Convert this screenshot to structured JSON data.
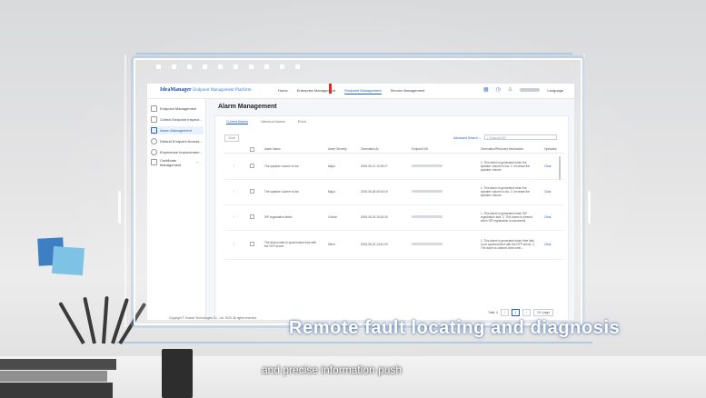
{
  "app": {
    "brand": "IdeaManager",
    "brand_sub": "Endpoint Management Platform",
    "nav": [
      "Home",
      "Enterprise Management",
      "Endpoint Management",
      "Service Management"
    ],
    "nav_active_index": 2,
    "language": "Language",
    "sidebar": [
      {
        "label": "Endpoint Management",
        "icon": "monitor-icon"
      },
      {
        "label": "Collect Endpoint Inspect...",
        "icon": "clipboard-icon"
      },
      {
        "label": "Alarm Management",
        "icon": "bell-icon",
        "active": true
      },
      {
        "label": "Default Endpoint Access...",
        "icon": "gear-icon"
      },
      {
        "label": "Experience Improvemen...",
        "icon": "chart-icon"
      },
      {
        "label": "Certificate Management",
        "icon": "certificate-icon"
      }
    ],
    "page_title": "Alarm Management",
    "tabs": [
      "Current Alarms",
      "Historical Alarms",
      "Event"
    ],
    "clear_button": "Clear",
    "advanced_search": "Advanced Search",
    "search_placeholder": "Endpoint SN",
    "columns": [
      "Alarm Name",
      "Alarm Severity",
      "Generation At",
      "Endpoint SN",
      "Generation/Recovery Mechanism",
      "Operation"
    ],
    "rows": [
      {
        "name": "The speaker volume is low.",
        "severity": "Major",
        "time": "2025-06-12 10:25:27",
        "mechanism": "1. This alarm is generated when the speaker volume is low. 2. Increase the speaker volume.",
        "operation": "Clear"
      },
      {
        "name": "The speaker volume is low.",
        "severity": "Major",
        "time": "2025-06-28 09:24:19",
        "mechanism": "1. This alarm is generated when the speaker volume is low. 2. Increase the speaker volume.",
        "operation": "Clear"
      },
      {
        "name": "SIP registration failed.",
        "severity": "Critical",
        "time": "2025-06-24 15:15:33",
        "mechanism": "1. This alarm is generated when SIP registration fails. 2. This alarm is cleared when SIP registration is successful.",
        "operation": "Clear"
      },
      {
        "name": "The device fails to synchronize time with the NTP server.",
        "severity": "Minor",
        "time": "2025-06-24 14:51:03",
        "mechanism": "1. This alarm is generated when time fails to be synchronized with the NTP server. 2. The alarm is cleared when time...",
        "operation": "Clear"
      }
    ],
    "pager": {
      "total": "Total: 4",
      "current_page": "1",
      "page_size": "10 / page"
    },
    "copyright": "Copyright © Huawei Technologies Co., Ltd. 2025. All rights reserved."
  },
  "overlay": {
    "caption": "Remote fault locating and diagnosis",
    "subcaption": "and precise information push"
  },
  "colors": {
    "accent": "#1e62d0",
    "brand": "#1a4f9c",
    "highlight_mark": "#e02828"
  }
}
